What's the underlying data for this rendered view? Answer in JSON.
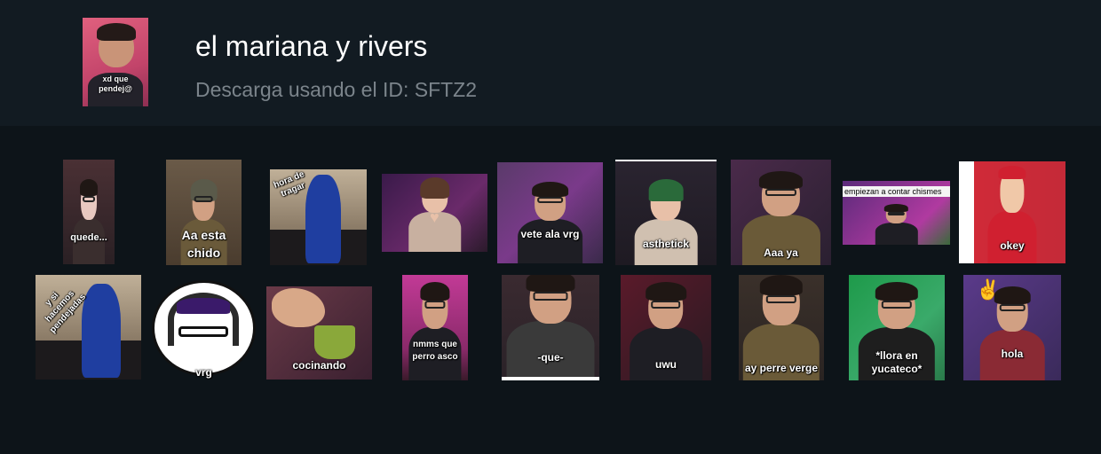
{
  "pack": {
    "title": "el mariana y rivers",
    "subtitle": "Descarga usando el ID: SFTZ2",
    "thumbnail_caption": "xd que pendej@"
  },
  "stickers": [
    {
      "name": "sticker-quede",
      "caption": "quede...",
      "bg": "#3a2a2e"
    },
    {
      "name": "sticker-aa-esta-chido",
      "caption": "Aa esta chido",
      "bg": "#5a4a38"
    },
    {
      "name": "sticker-hora-de-tragar",
      "caption": "hora de tragar",
      "bg": "#9c8a72"
    },
    {
      "name": "sticker-heart-hands",
      "caption": "",
      "bg": "#3a2246"
    },
    {
      "name": "sticker-vete-ala-vrg",
      "caption": "vete ala vrg",
      "bg": "#5a3a6a"
    },
    {
      "name": "sticker-asthetick",
      "caption": "asthetick",
      "bg": "#23202a"
    },
    {
      "name": "sticker-aaa-ya",
      "caption": "Aaa ya",
      "bg": "#3a2a3a"
    },
    {
      "name": "sticker-empiezan-a-contar-chismes",
      "caption": "empiezan a  contar chismes",
      "bg": "#6a3a7a"
    },
    {
      "name": "sticker-okey",
      "caption": "okey",
      "bg": "#c42a38"
    },
    {
      "name": "sticker-y-si-hacemos-pendejadas",
      "caption": "y si hacemos pendejadas",
      "bg": "#7a6a58"
    },
    {
      "name": "sticker-vrg",
      "caption": "vrg",
      "bg": "#ffffff"
    },
    {
      "name": "sticker-cocinando",
      "caption": "cocinando",
      "bg": "#4a2a38"
    },
    {
      "name": "sticker-nmms-que-perro-asco",
      "caption": "nmms que perro asco",
      "bg": "#b03a86"
    },
    {
      "name": "sticker-que",
      "caption": "-que-",
      "bg": "#2a2228"
    },
    {
      "name": "sticker-uwu",
      "caption": "uwu",
      "bg": "#3a1a2a"
    },
    {
      "name": "sticker-ay-perre-verge",
      "caption": "ay perre verge",
      "bg": "#2a2422"
    },
    {
      "name": "sticker-llora-en-yucateco",
      "caption": "*llora en yucateco*",
      "bg": "#2e9a5a"
    },
    {
      "name": "sticker-hola",
      "caption": "hola",
      "bg": "#5a3a7a"
    }
  ]
}
